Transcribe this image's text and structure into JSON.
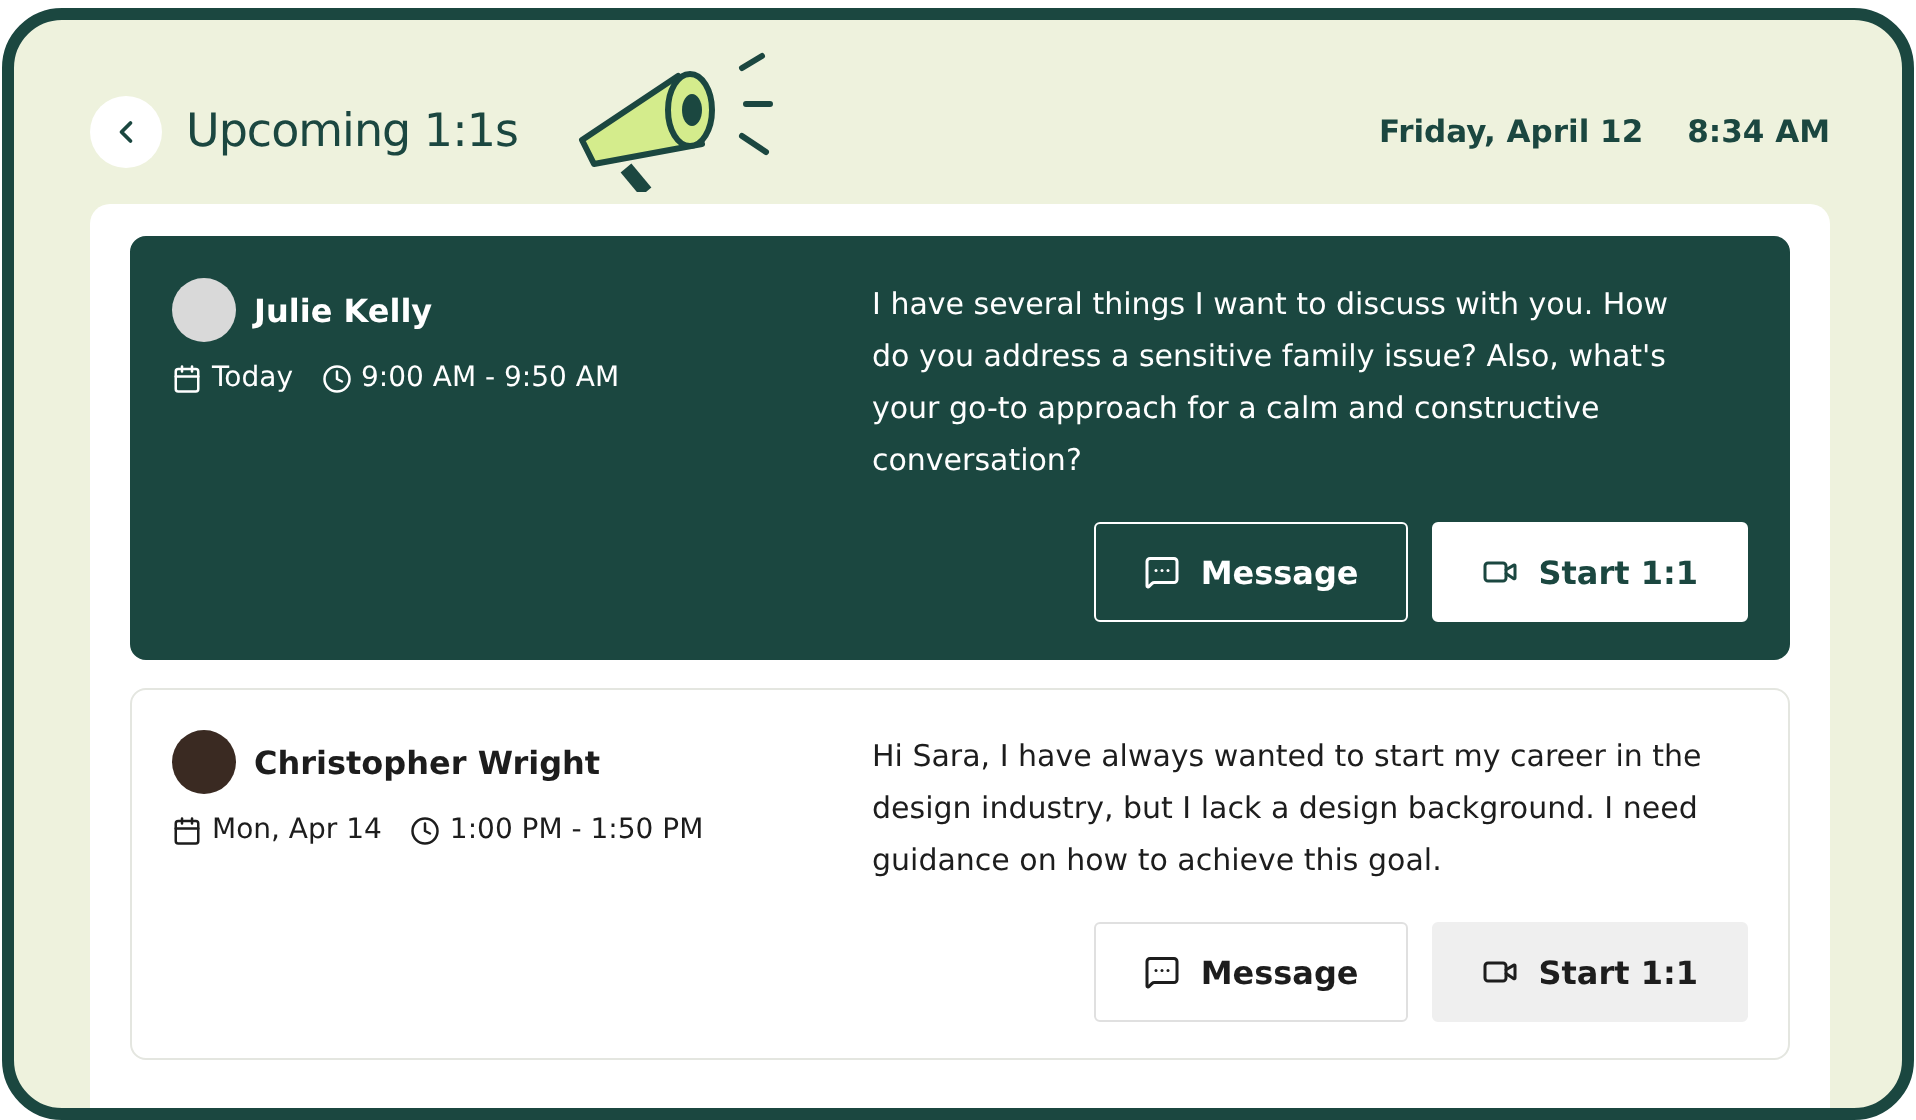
{
  "header": {
    "title": "Upcoming 1:1s",
    "date": "Friday, April 12",
    "time": "8:34 AM"
  },
  "meetings": [
    {
      "name": "Julie Kelly",
      "day": "Today",
      "time": "9:00 AM - 9:50 AM",
      "message": "I have several things I want to discuss with you. How do you address a sensitive family issue? Also, what's your go-to approach for a calm and constructive conversation?",
      "selected": true,
      "buttons": [
        "Message",
        "Start 1:1"
      ]
    },
    {
      "name": "Christopher Wright",
      "day": "Mon, Apr 14",
      "time": "1:00 PM - 1:50 PM",
      "message": "Hi Sara, I have always wanted to start my career in the design industry, but I lack a design background. I need guidance on how to achieve this goal.",
      "selected": false,
      "buttons": [
        "Message",
        "Start 1:1"
      ]
    }
  ]
}
